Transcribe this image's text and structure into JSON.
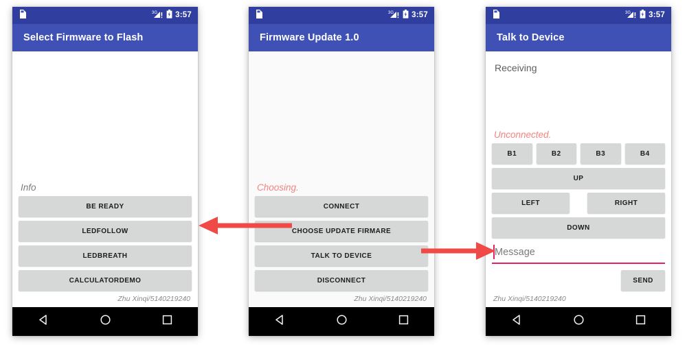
{
  "status_bar": {
    "time": "3:57",
    "sdcard_icon": "sdcard-icon",
    "signal_icon": "signal-3g-icon",
    "signal_label": "3G",
    "battery_icon": "battery-icon"
  },
  "nav_bar": {
    "back_icon": "back-triangle-icon",
    "home_icon": "home-circle-icon",
    "recents_icon": "recents-square-icon"
  },
  "colors": {
    "app_bar": "#3f51b5",
    "status_bar": "#303f9f",
    "button": "#d6d7d7",
    "accent_pink": "#e91e63",
    "alert_text": "#f4837f",
    "arrow": "#ef4a46",
    "nav_bar": "#000000"
  },
  "footer_credit": "Zhu Xinqi/5140219240",
  "screens": [
    {
      "id": "select-firmware",
      "title": "Select Firmware to Flash",
      "status_text": "Info",
      "buttons": [
        {
          "name": "be-ready-button",
          "label": "BE READY"
        },
        {
          "name": "ledfollow-button",
          "label": "LEDFOLLOW"
        },
        {
          "name": "ledbreath-button",
          "label": "LEDBREATH"
        },
        {
          "name": "calculatordemo-button",
          "label": "CALCULATORDEMO"
        }
      ]
    },
    {
      "id": "firmware-update",
      "title": "Firmware Update 1.0",
      "status_text": "Choosing.",
      "buttons": [
        {
          "name": "connect-button",
          "label": "CONNECT"
        },
        {
          "name": "choose-update-firmare-button",
          "label": "CHOOSE UPDATE FIRMARE"
        },
        {
          "name": "talk-to-device-button",
          "label": "TALK TO DEVICE"
        },
        {
          "name": "disconnect-button",
          "label": "DISCONNECT"
        }
      ]
    },
    {
      "id": "talk-to-device",
      "title": "Talk to Device",
      "receiving_label": "Receiving",
      "status_text": "Unconnected.",
      "b_buttons": [
        {
          "name": "b1-button",
          "label": "B1"
        },
        {
          "name": "b2-button",
          "label": "B2"
        },
        {
          "name": "b3-button",
          "label": "B3"
        },
        {
          "name": "b4-button",
          "label": "B4"
        }
      ],
      "up_label": "UP",
      "left_label": "LEFT",
      "right_label": "RIGHT",
      "down_label": "DOWN",
      "message_placeholder": "Message",
      "message_value": "",
      "send_label": "SEND"
    }
  ],
  "arrows": [
    {
      "name": "arrow-choose-firmware-to-select-screen",
      "direction": "left"
    },
    {
      "name": "arrow-talk-to-device-to-talk-screen",
      "direction": "right"
    }
  ]
}
